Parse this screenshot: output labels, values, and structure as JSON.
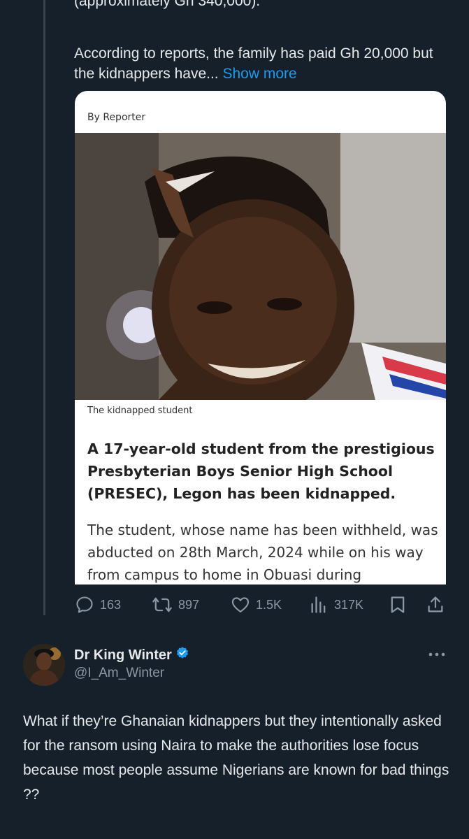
{
  "quoted_tweet": {
    "cut_line": "(approximately Gh 340,000).",
    "body": "According to reports, the family has paid  Gh 20,000 but the kidnappers have...",
    "show_more": "Show more",
    "card": {
      "byline": "By Reporter",
      "caption": "The kidnapped student",
      "headline": "A 17-year-old student from the prestigious Presbyterian Boys Senior High School (PRESEC), Legon has been kidnapped.",
      "paragraph": "The student, whose name has been withheld, was abducted on 28th March, 2024 while on his way from campus to home in Obuasi during"
    },
    "actions": {
      "replies": "163",
      "reposts": "897",
      "likes": "1.5K",
      "views": "317K"
    }
  },
  "reply": {
    "display_name": "Dr King Winter",
    "handle": "@I_Am_Winter",
    "text": "What if they’re Ghanaian kidnappers but they intentionally asked for the ransom using Naira to make the authorities lose focus because most people assume Nigerians are known for bad things ??"
  },
  "icons": [
    "reply-icon",
    "repost-icon",
    "like-icon",
    "views-icon",
    "bookmark-icon",
    "share-icon",
    "verified-badge-icon",
    "more-icon"
  ],
  "colors": {
    "background": "#15202b",
    "link": "#1d9bf0",
    "muted": "#8b98a5",
    "verified": "#1d9bf0"
  }
}
